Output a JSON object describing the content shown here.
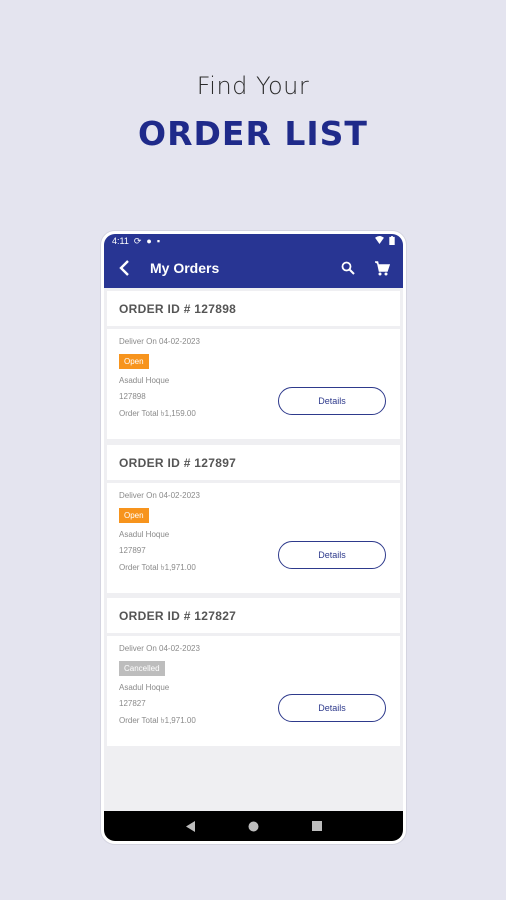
{
  "promo": {
    "line1": "Find Your",
    "line2": "ORDER LIST"
  },
  "statusbar": {
    "time": "4:11",
    "icons_left": [
      "sync-icon",
      "notification-icon",
      "sim-icon"
    ],
    "icons_right": [
      "wifi-icon",
      "battery-icon"
    ]
  },
  "appbar": {
    "title": "My Orders",
    "back_icon": "arrow-back-icon",
    "actions": [
      "search-icon",
      "cart-icon"
    ]
  },
  "orders": [
    {
      "id_label": "ORDER ID # 127898",
      "deliver": "Deliver On 04-02-2023",
      "status": "Open",
      "customer": "Asadul  Hoque",
      "order_no": "127898",
      "total": "Order Total ৳1,159.00",
      "button": "Details"
    },
    {
      "id_label": "ORDER ID # 127897",
      "deliver": "Deliver On 04-02-2023",
      "status": "Open",
      "customer": "Asadul  Hoque",
      "order_no": "127897",
      "total": "Order Total ৳1,971.00",
      "button": "Details"
    },
    {
      "id_label": "ORDER ID # 127827",
      "deliver": "Deliver On 04-02-2023",
      "status": "Cancelled",
      "customer": "Asadul  Hoque",
      "order_no": "127827",
      "total": "Order Total ৳1,971.00",
      "button": "Details"
    }
  ],
  "navbar": {
    "icons": [
      "back-triangle-icon",
      "home-circle-icon",
      "recents-square-icon"
    ]
  },
  "colors": {
    "primary": "#283593",
    "accent": "#f7941d",
    "cancelled": "#bdbdbd",
    "background": "#e4e4ef"
  }
}
